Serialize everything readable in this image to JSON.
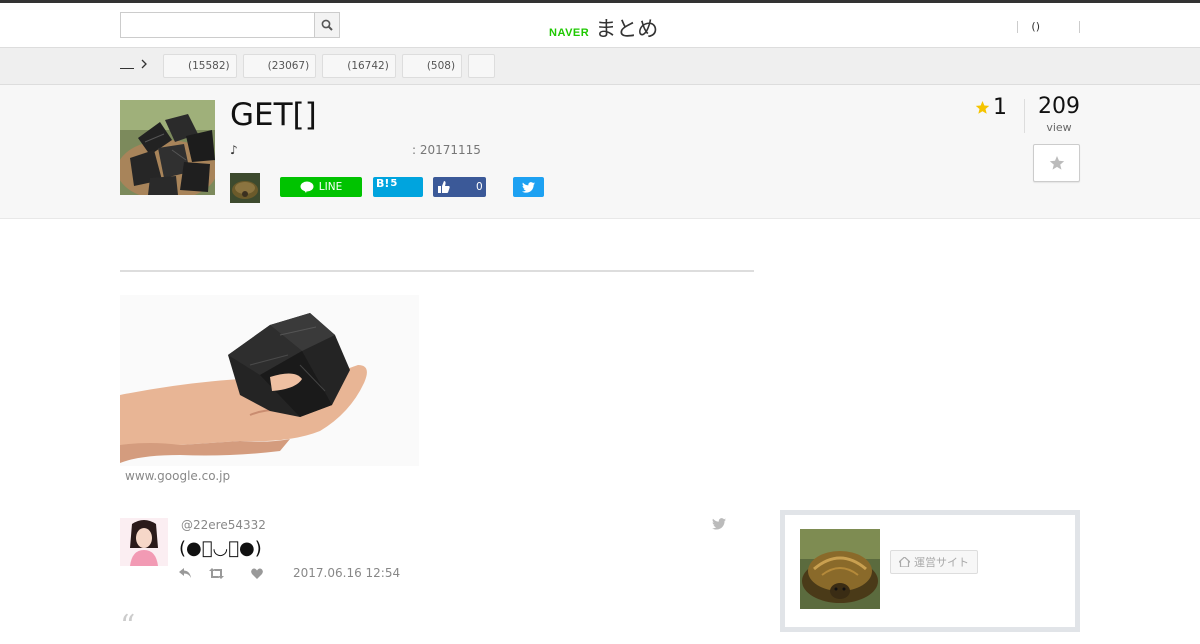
{
  "header": {
    "search_placeholder": "",
    "logo_brand": "NAVER",
    "logo_service": "まとめ",
    "nav_item": "()"
  },
  "categories": {
    "breadcrumb_home": "",
    "items": [
      {
        "label": "(15582)"
      },
      {
        "label": "(23067)"
      },
      {
        "label": "(16742)"
      },
      {
        "label": "(508)"
      }
    ]
  },
  "article": {
    "title": "GET[]",
    "description": "♪",
    "date": ": 20171115",
    "favorites": "1",
    "views": "209",
    "views_label": "view",
    "share": {
      "line_label": "LINE",
      "hatena_label": "B!",
      "hatena_count": "5",
      "facebook_count": "0"
    }
  },
  "content": {
    "image_source": "www.google.co.jp",
    "tweet": {
      "handle": "@22ere54332",
      "text": "(●ో◡ో●)",
      "time": "2017.06.16 12:54"
    },
    "quote_mark": "“"
  },
  "sidebar": {
    "site_button": "運営サイト"
  },
  "colors": {
    "naver_green": "#1ec800",
    "line_green": "#00c300",
    "hatena_blue": "#00a4de",
    "facebook_blue": "#3b5998",
    "twitter_blue": "#1da1f2",
    "star_gold": "#f5c400"
  },
  "icons": [
    "search-icon",
    "chevron-right-icon",
    "star-icon",
    "line-icon",
    "thumbs-up-icon",
    "twitter-icon",
    "reply-icon",
    "retweet-icon",
    "heart-icon",
    "home-icon"
  ]
}
